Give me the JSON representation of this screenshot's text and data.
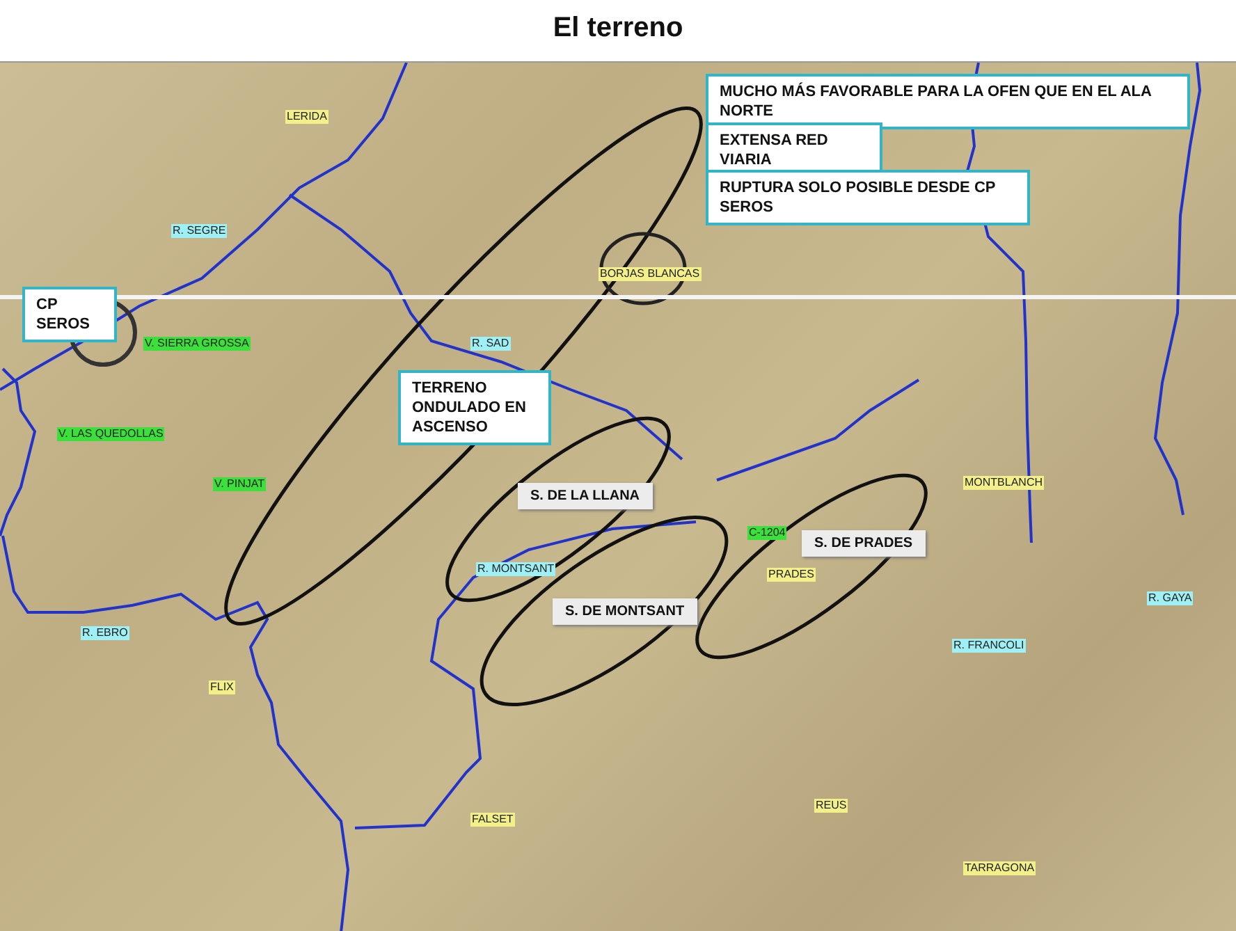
{
  "title": "El terreno",
  "map": {
    "callouts": [
      {
        "text": "MUCHO MÁS FAVORABLE PARA LA OFEN QUE EN EL ALA NORTE"
      },
      {
        "text": "EXTENSA RED VIARIA"
      },
      {
        "text": "RUPTURA SOLO POSIBLE DESDE CP SEROS"
      },
      {
        "text": "CP SEROS"
      },
      {
        "text": "TERRENO ONDULADO EN ASCENSO"
      }
    ],
    "ranges": [
      {
        "text": "S. DE LA LLANA"
      },
      {
        "text": "S. DE MONTSANT"
      },
      {
        "text": "S. DE PRADES"
      }
    ],
    "labels": [
      {
        "kind": "town",
        "text": "LERIDA"
      },
      {
        "kind": "river",
        "text": "R. SEGRE"
      },
      {
        "kind": "town",
        "text": "BORJAS BLANCAS"
      },
      {
        "kind": "river",
        "text": "R. SAD"
      },
      {
        "kind": "height",
        "text": "V. SIERRA GROSSA"
      },
      {
        "kind": "height",
        "text": "V. LAS QUEDOLLAS"
      },
      {
        "kind": "height",
        "text": "V. PINJAT"
      },
      {
        "kind": "town",
        "text": "MONTBLANCH"
      },
      {
        "kind": "height",
        "text": "C-1204"
      },
      {
        "kind": "town",
        "text": "PRADES"
      },
      {
        "kind": "river",
        "text": "R. MONTSANT"
      },
      {
        "kind": "river",
        "text": "R. EBRO"
      },
      {
        "kind": "river",
        "text": "R. GAYA"
      },
      {
        "kind": "river",
        "text": "R. FRANCOLI"
      },
      {
        "kind": "town",
        "text": "FLIX"
      },
      {
        "kind": "town",
        "text": "FALSET"
      },
      {
        "kind": "town",
        "text": "REUS"
      },
      {
        "kind": "town",
        "text": "TARRAGONA"
      }
    ]
  }
}
